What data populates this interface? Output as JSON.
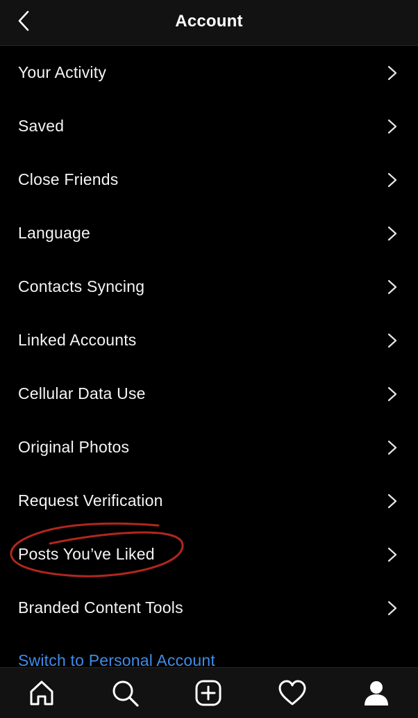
{
  "header": {
    "title": "Account",
    "back_icon": "chevron-left-icon"
  },
  "menu": {
    "items": [
      {
        "label": "Your Activity"
      },
      {
        "label": "Saved"
      },
      {
        "label": "Close Friends"
      },
      {
        "label": "Language"
      },
      {
        "label": "Contacts Syncing"
      },
      {
        "label": "Linked Accounts"
      },
      {
        "label": "Cellular Data Use"
      },
      {
        "label": "Original Photos"
      },
      {
        "label": "Request Verification"
      },
      {
        "label": "Posts You’ve Liked"
      },
      {
        "label": "Branded Content Tools"
      }
    ],
    "switch_account_label": "Switch to Personal Account"
  },
  "annotation": {
    "highlighted_item": "Posts You’ve Liked",
    "mark_color": "#b3261e"
  },
  "tabbar": {
    "tabs": [
      "home-icon",
      "search-icon",
      "new-post-icon",
      "activity-heart-icon",
      "profile-icon"
    ]
  },
  "colors": {
    "background": "#000000",
    "header_background": "#121212",
    "text": "#f5f5f5",
    "link": "#3f8be8"
  }
}
